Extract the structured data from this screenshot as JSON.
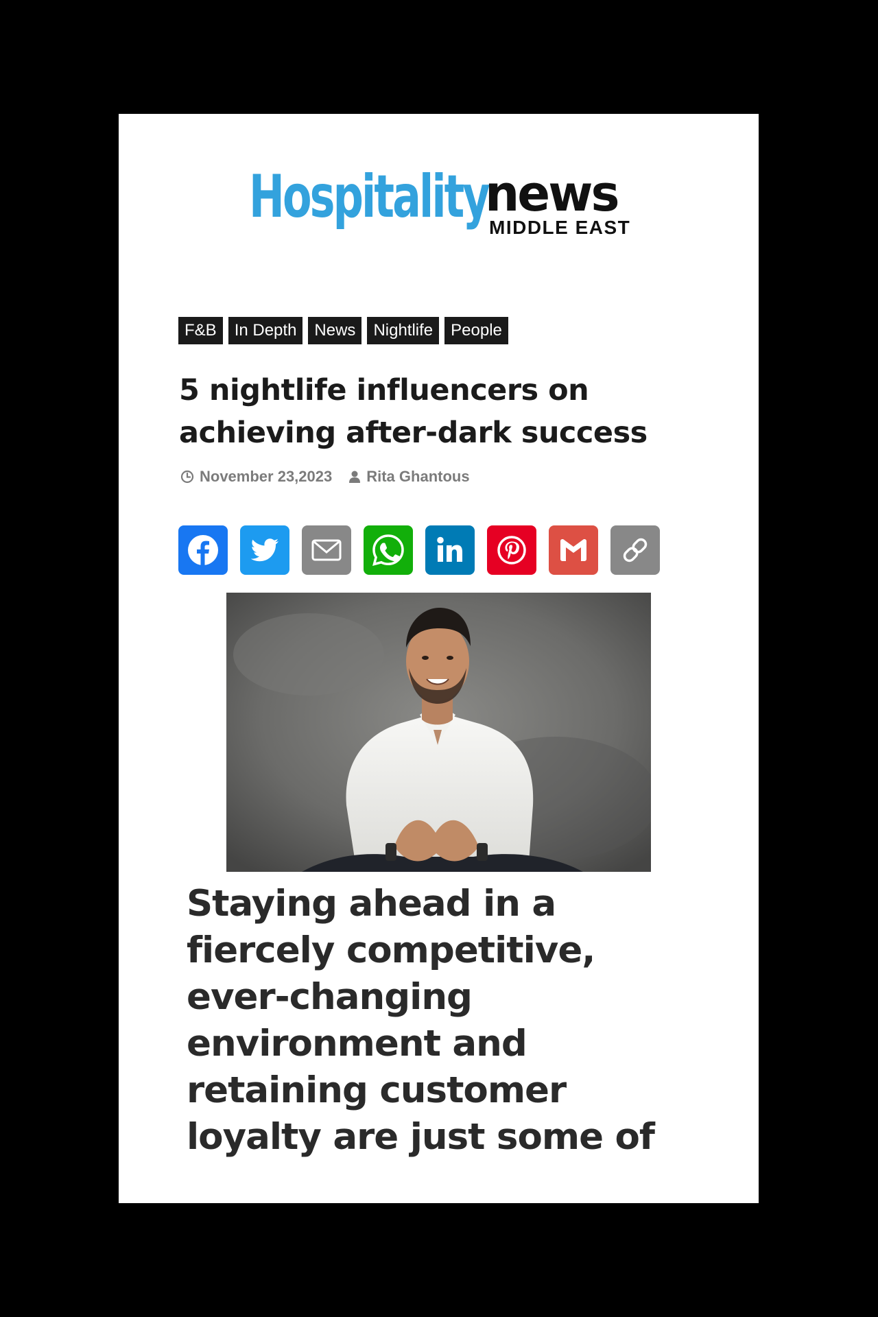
{
  "logo": {
    "part_hospitality": "Hospitality",
    "part_news": "news",
    "part_region": "MIDDLE EAST"
  },
  "tags": [
    "F&B",
    "In Depth",
    "News",
    "Nightlife",
    "People"
  ],
  "article": {
    "headline": "5 nightlife influencers on achieving after-dark success",
    "date": "November 23,2023",
    "author": "Rita Ghantous",
    "lead": "Staying ahead in a fiercely competitive, ever-changing environment and retaining customer loyalty are just some of"
  },
  "share": [
    {
      "name": "facebook",
      "icon": "facebook-icon",
      "color": "#1877f2"
    },
    {
      "name": "twitter",
      "icon": "twitter-icon",
      "color": "#1d9bf0"
    },
    {
      "name": "email",
      "icon": "email-icon",
      "color": "#888888"
    },
    {
      "name": "whatsapp",
      "icon": "whatsapp-icon",
      "color": "#12af0a"
    },
    {
      "name": "linkedin",
      "icon": "linkedin-icon",
      "color": "#007bb5"
    },
    {
      "name": "pinterest",
      "icon": "pinterest-icon",
      "color": "#e60023"
    },
    {
      "name": "gmail",
      "icon": "gmail-icon",
      "color": "#dd5044"
    },
    {
      "name": "copy-link",
      "icon": "link-icon",
      "color": "#888888"
    }
  ],
  "colors": {
    "brand_blue": "#33a2dd",
    "tag_bg": "#1a1a1a",
    "meta_gray": "#7b7b7b"
  }
}
